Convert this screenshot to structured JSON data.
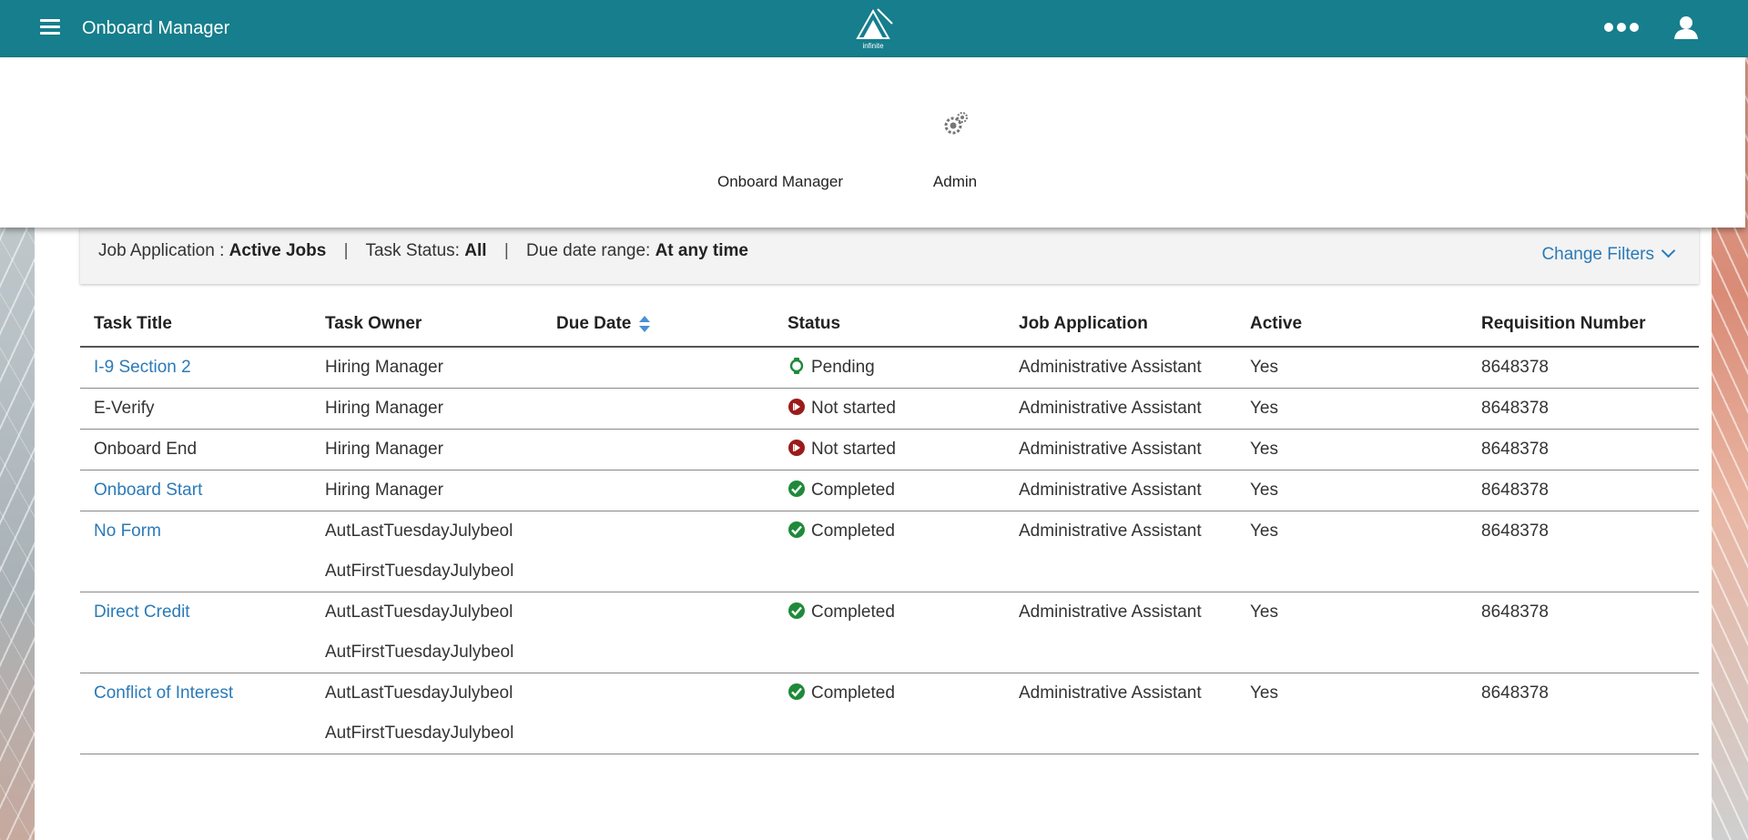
{
  "header": {
    "app_title": "Onboard Manager",
    "logo_text": "infinite",
    "icons": [
      "hamburger-menu-icon",
      "logo-icon",
      "more-options-icon",
      "user-icon"
    ]
  },
  "menu": {
    "items": [
      {
        "label": "Onboard Manager"
      },
      {
        "label": "Admin",
        "icon": "gears-icon"
      }
    ]
  },
  "filters": {
    "job_application_label": "Job Application :",
    "job_application_value": "Active Jobs",
    "task_status_label": "Task Status:",
    "task_status_value": "All",
    "due_date_label": "Due date range:",
    "due_date_value": "At any time",
    "separator": "|",
    "change_filters_label": "Change Filters"
  },
  "table": {
    "columns": [
      "Task Title",
      "Task Owner",
      "Due Date",
      "Status",
      "Job Application",
      "Active",
      "Requisition Number"
    ],
    "rows": [
      {
        "title": "I-9 Section 2",
        "title_link": true,
        "owners": [
          "Hiring Manager"
        ],
        "due_date": "",
        "status": "Pending",
        "status_type": "pending",
        "job": "Administrative Assistant",
        "active": "Yes",
        "req": "8648378"
      },
      {
        "title": "E-Verify",
        "title_link": false,
        "owners": [
          "Hiring Manager"
        ],
        "due_date": "",
        "status": "Not started",
        "status_type": "not-started",
        "job": "Administrative Assistant",
        "active": "Yes",
        "req": "8648378"
      },
      {
        "title": "Onboard End",
        "title_link": false,
        "owners": [
          "Hiring Manager"
        ],
        "due_date": "",
        "status": "Not started",
        "status_type": "not-started",
        "job": "Administrative Assistant",
        "active": "Yes",
        "req": "8648378"
      },
      {
        "title": "Onboard Start",
        "title_link": true,
        "owners": [
          "Hiring Manager"
        ],
        "due_date": "",
        "status": "Completed",
        "status_type": "completed",
        "job": "Administrative Assistant",
        "active": "Yes",
        "req": "8648378"
      },
      {
        "title": "No Form",
        "title_link": true,
        "owners": [
          "AutLastTuesdayJulybeol",
          "AutFirstTuesdayJulybeol"
        ],
        "due_date": "",
        "status": "Completed",
        "status_type": "completed",
        "job": "Administrative Assistant",
        "active": "Yes",
        "req": "8648378"
      },
      {
        "title": "Direct Credit",
        "title_link": true,
        "owners": [
          "AutLastTuesdayJulybeol",
          "AutFirstTuesdayJulybeol"
        ],
        "due_date": "",
        "status": "Completed",
        "status_type": "completed",
        "job": "Administrative Assistant",
        "active": "Yes",
        "req": "8648378"
      },
      {
        "title": "Conflict of Interest",
        "title_link": true,
        "owners": [
          "AutLastTuesdayJulybeol",
          "AutFirstTuesdayJulybeol"
        ],
        "due_date": "",
        "status": "Completed",
        "status_type": "completed",
        "job": "Administrative Assistant",
        "active": "Yes",
        "req": "8648378"
      }
    ]
  },
  "colors": {
    "topbar": "#167e8c",
    "link": "#2a7ab8",
    "completed": "#1f8a3a",
    "pending": "#1f8a3a",
    "not_started": "#9b1b1b"
  }
}
